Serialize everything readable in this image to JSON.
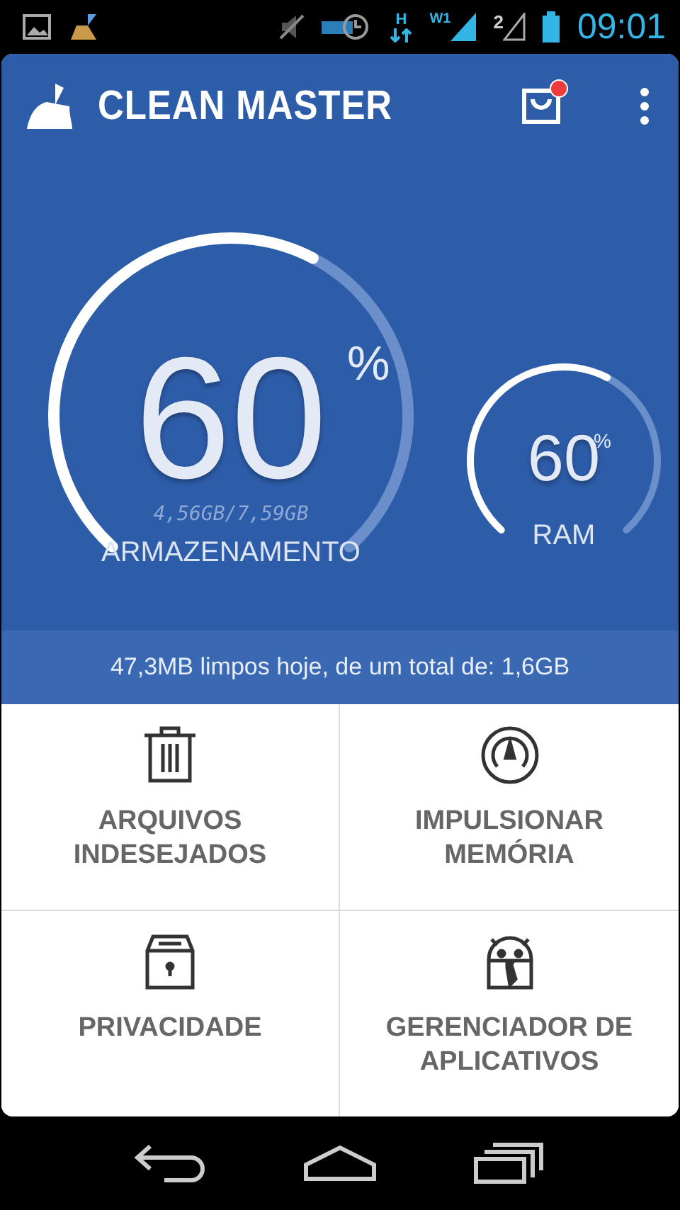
{
  "status_bar": {
    "network_type": "H",
    "sim1": "W1",
    "sim2": "2",
    "time": "09:01"
  },
  "header": {
    "title": "CLEAN MASTER",
    "store_notification": true
  },
  "gauges": [
    {
      "kind": "large",
      "value": "60",
      "unit": "%",
      "detail": "4,56GB/7,59GB",
      "label": "ARMAZENAMENTO"
    },
    {
      "kind": "small",
      "value": "60",
      "unit": "%",
      "label": "RAM"
    }
  ],
  "summary": "47,3MB limpos hoje, de um total de: 1,6GB",
  "tiles": [
    {
      "kind": "trash",
      "label": "ARQUIVOS INDESEJADOS"
    },
    {
      "kind": "gauge",
      "label": "IMPULSIONAR MEMÓRIA"
    },
    {
      "kind": "lockbox",
      "label": "PRIVACIDADE"
    },
    {
      "kind": "robot",
      "label": "GERENCIADOR DE APLICATIVOS"
    }
  ]
}
